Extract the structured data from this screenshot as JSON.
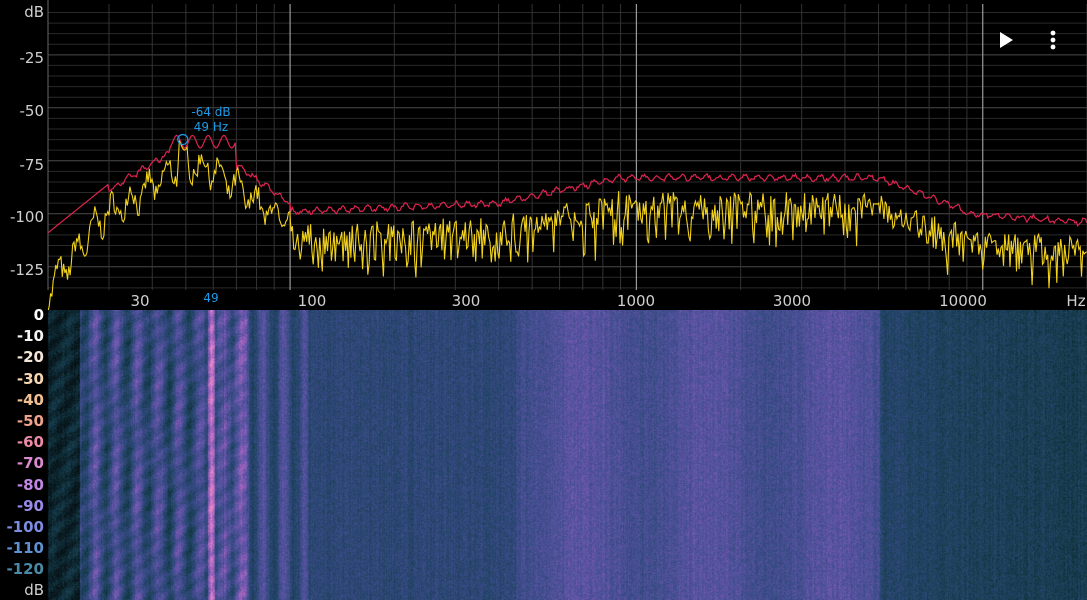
{
  "spectrum": {
    "y_unit": "dB",
    "x_unit": "Hz",
    "y_ticks": [
      "-25",
      "-50",
      "-75",
      "-100",
      "-125"
    ],
    "x_ticks": [
      "30",
      "100",
      "300",
      "1000",
      "3000",
      "10000"
    ],
    "peak": {
      "db": "-64 dB",
      "hz": "49 Hz",
      "axis_marker": "49"
    },
    "colors": {
      "max_hold": "#e0234f",
      "live": "#f2d21b",
      "peak": "#1e9be8",
      "grid": "#3a3a3a"
    }
  },
  "spectrogram": {
    "scale_labels": [
      "0",
      "-10",
      "-20",
      "-30",
      "-40",
      "-50",
      "-60",
      "-70",
      "-80",
      "-90",
      "-100",
      "-110",
      "-120"
    ],
    "scale_unit": "dB",
    "scale_colors": [
      "#ffffff",
      "#f4f4f4",
      "#f2e6d6",
      "#f4d6b0",
      "#f2c090",
      "#efa28c",
      "#ea8aa6",
      "#dc8ad0",
      "#c088e4",
      "#9a8ae8",
      "#7c8ce0",
      "#5e90d4",
      "#4a8aa8"
    ]
  },
  "toolbar": {
    "play_icon": "play-icon",
    "menu_icon": "more-vert-icon"
  }
}
